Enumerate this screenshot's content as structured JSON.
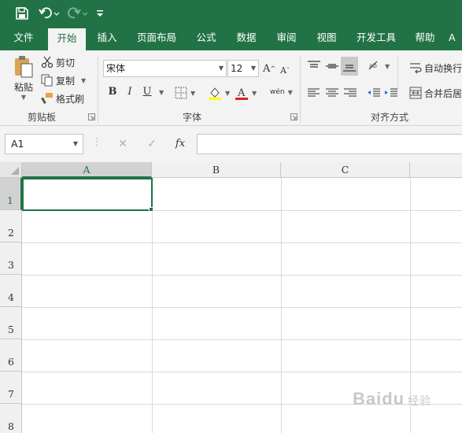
{
  "quick_access": {
    "save": "save-icon",
    "undo": "undo-icon",
    "redo": "redo-icon",
    "customize": "customize-icon"
  },
  "tabs": [
    "文件",
    "开始",
    "插入",
    "页面布局",
    "公式",
    "数据",
    "审阅",
    "视图",
    "开发工具",
    "帮助",
    "A"
  ],
  "active_tab": "开始",
  "ribbon": {
    "clipboard": {
      "paste": "粘贴",
      "cut": "剪切",
      "copy": "复制",
      "format_painter": "格式刷",
      "group_label": "剪贴板"
    },
    "font": {
      "font_name": "宋体",
      "font_size": "12",
      "bold": "B",
      "italic": "I",
      "underline": "U",
      "phonetic": "wén",
      "group_label": "字体"
    },
    "alignment": {
      "wrap_text": "自动换行",
      "merge_center": "合并后居",
      "group_label": "对齐方式"
    }
  },
  "formula_bar": {
    "name_box": "A1",
    "cancel": "✕",
    "enter": "✓",
    "fx": "fx",
    "value": ""
  },
  "sheet": {
    "columns": [
      "A",
      "B",
      "C"
    ],
    "rows": [
      "1",
      "2",
      "3",
      "4",
      "5",
      "6",
      "7",
      "8"
    ],
    "selected_cell": "A1"
  },
  "watermark": {
    "brand": "Baidu",
    "suffix": "经验"
  },
  "colors": {
    "accent": "#217346",
    "ribbon_bg": "#f3f3f3"
  }
}
